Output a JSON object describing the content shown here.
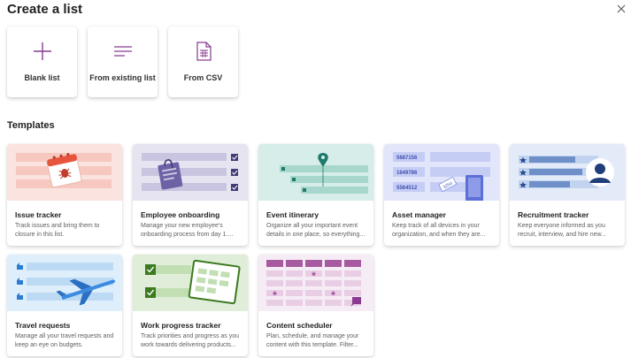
{
  "dialog": {
    "title": "Create a list"
  },
  "options": [
    {
      "label": "Blank list",
      "icon": "plus-icon"
    },
    {
      "label": "From existing list",
      "icon": "list-lines-icon"
    },
    {
      "label": "From CSV",
      "icon": "csv-file-icon"
    }
  ],
  "templates_heading": "Templates",
  "templates": [
    {
      "title": "Issue tracker",
      "desc": "Track issues and bring them to closure in this list."
    },
    {
      "title": "Employee onboarding",
      "desc": "Manage your new employee's onboarding process from day 1...."
    },
    {
      "title": "Event itinerary",
      "desc": "Organize all your important event details in one place, so everything..."
    },
    {
      "title": "Asset manager",
      "desc": "Keep track of all devices in your organization, and when they are..."
    },
    {
      "title": "Recruitment tracker",
      "desc": "Keep everyone informed as you recruit, interview, and hire new..."
    },
    {
      "title": "Travel requests",
      "desc": "Manage all your travel requests and keep an eye on budgets."
    },
    {
      "title": "Work progress tracker",
      "desc": "Track priorities and progress as you work towards delivering products..."
    },
    {
      "title": "Content scheduler",
      "desc": "Plan, schedule, and manage your content with this template. Filter..."
    }
  ],
  "asset_ids": [
    "5687156",
    "1649786",
    "5564512",
    "3254"
  ],
  "colors": {
    "accent": "#8a3b8f"
  }
}
